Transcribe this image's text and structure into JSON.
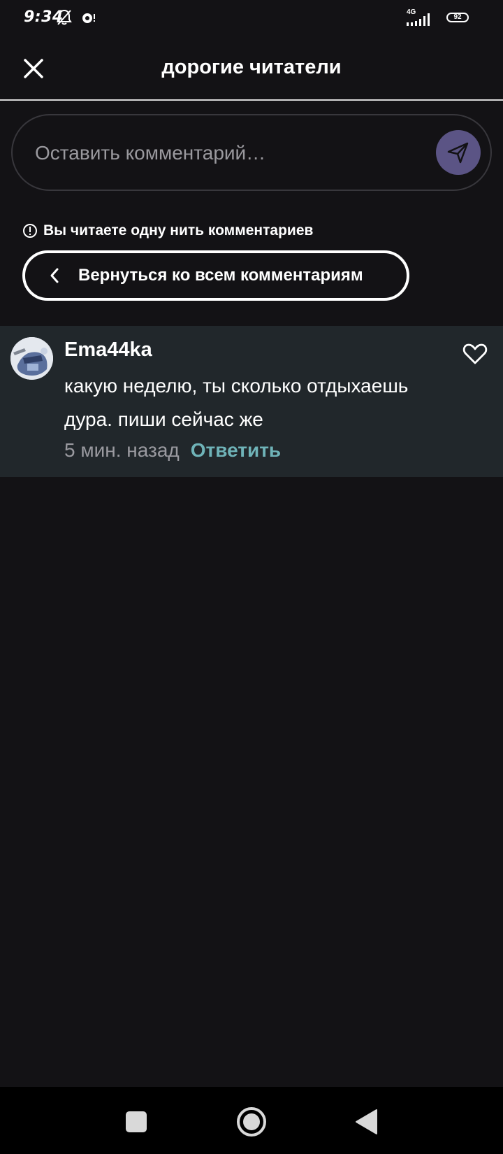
{
  "status_bar": {
    "time": "9:34",
    "network": "4G",
    "battery": "92",
    "icons": [
      "bell-off-icon",
      "notification-dot-icon",
      "signal-icon",
      "battery-icon"
    ]
  },
  "header": {
    "title": "дорогие читатели",
    "close_icon": "close-icon"
  },
  "comment_input": {
    "placeholder": "Оставить комментарий…",
    "value": "",
    "send_icon": "send-icon",
    "send_color": "#5b5485"
  },
  "thread_notice": {
    "icon": "info-icon",
    "text": "Вы читаете одну нить комментариев"
  },
  "back_button": {
    "icon": "chevron-left-icon",
    "label": "Вернуться ко всем комментариям"
  },
  "comments": [
    {
      "username": "Ema44ka",
      "text": "какую неделю, ты сколько отдыхаешь дура. пиши сейчас же",
      "timestamp": "5 мин. назад",
      "reply_label": "Ответить",
      "like_icon": "heart-outline-icon"
    }
  ],
  "nav_bar": {
    "buttons": [
      "recents-square-icon",
      "home-circle-icon",
      "back-triangle-icon"
    ]
  },
  "colors": {
    "background": "#131215",
    "comment_background": "#21272b",
    "reply_link": "#6fb3b8"
  }
}
